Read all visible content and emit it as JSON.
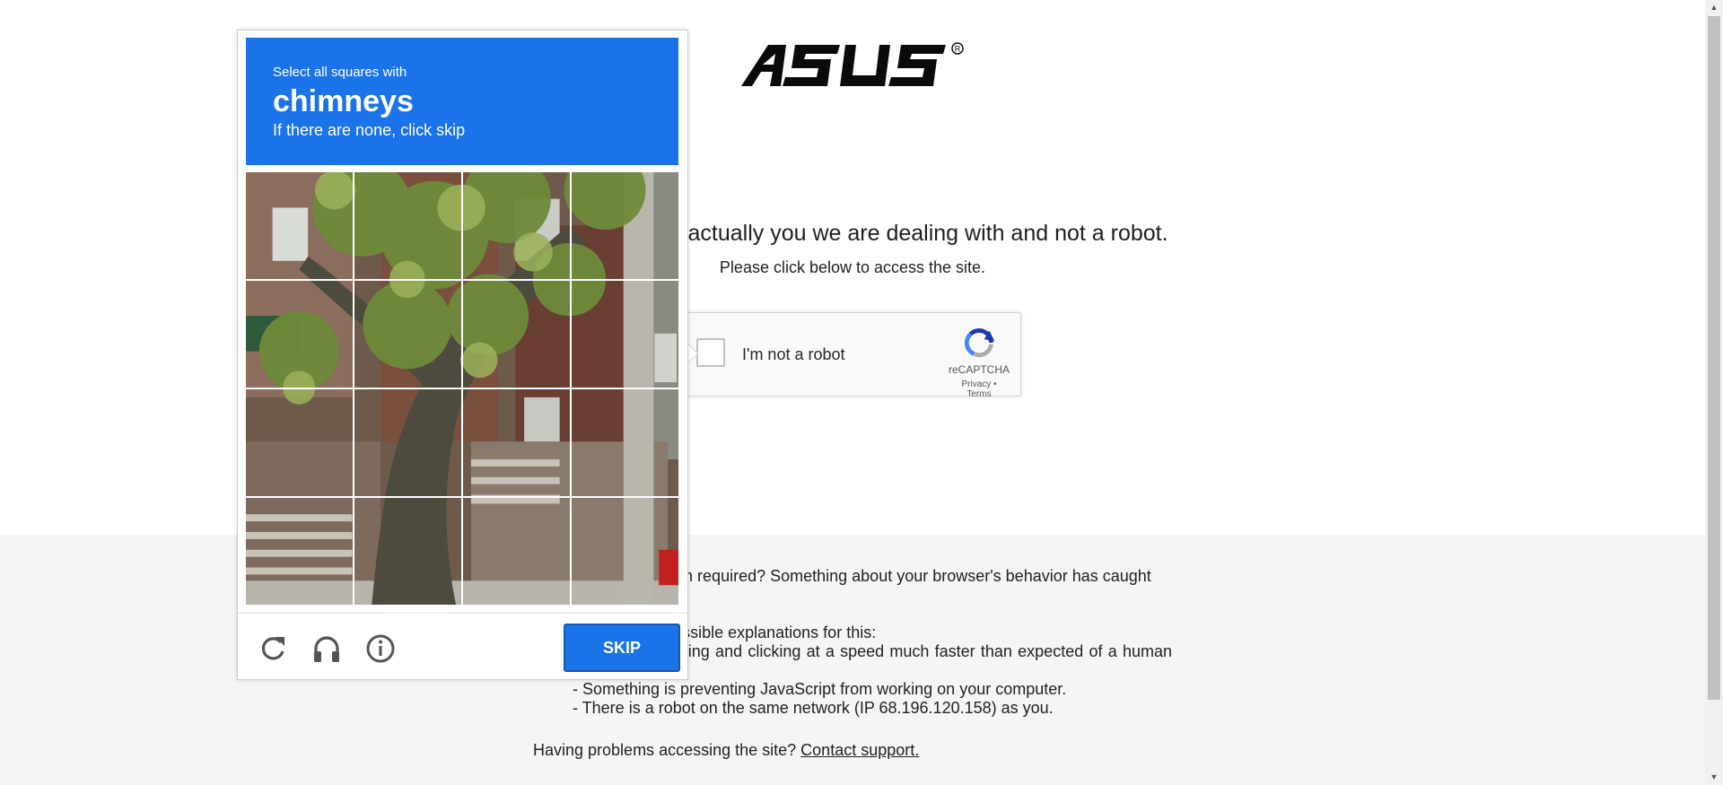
{
  "page": {
    "logo_text": "ASUS",
    "heading": "Make sure it is actually you we are dealing with and not a robot.",
    "subheading": "Please click below to access the site."
  },
  "recaptcha": {
    "checkbox_label": "I'm not a robot",
    "brand": "reCAPTCHA",
    "links": "Privacy • Terms"
  },
  "footer": {
    "para1": "Why is this verification required? Something about your browser's behavior has caught our attention.",
    "para2_intro": "There are various possible explanations for this:",
    "reasons": [
      "- You are browsing and clicking at a speed much faster than expected of a human being.",
      "- Something is preventing JavaScript from working on your computer.",
      "- There is a robot on the same network (IP 68.196.120.158) as you."
    ],
    "help_text": "Having problems accessing the site?",
    "help_link": "Contact support."
  },
  "challenge": {
    "instruction_line1": "Select all squares with",
    "target": "chimneys",
    "instruction_line3": "If there are none, click skip",
    "grid_rows": 4,
    "grid_cols": 4,
    "skip_label": "SKIP",
    "icons": [
      "reload-icon",
      "headphones-icon",
      "info-icon"
    ]
  },
  "colors": {
    "accent": "#1a73e8",
    "footer_bg": "#f5f5f5"
  }
}
